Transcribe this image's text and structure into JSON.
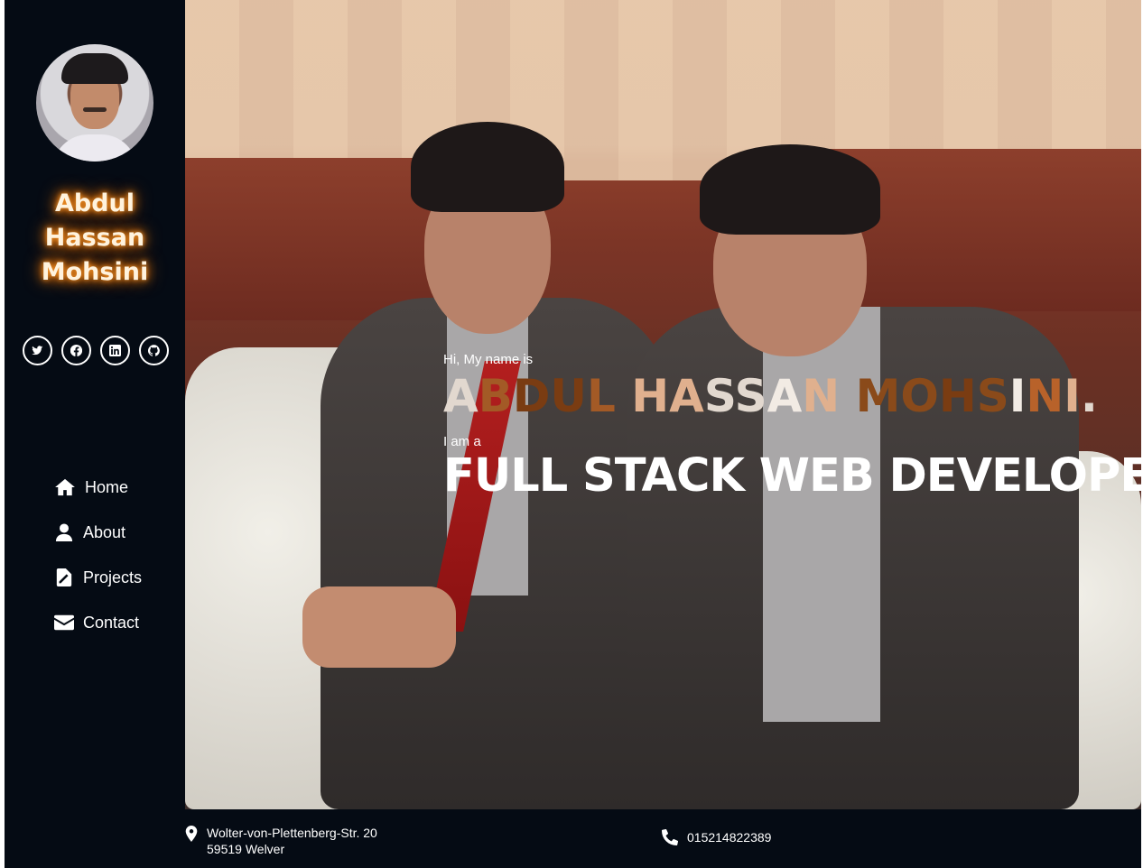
{
  "sidebar": {
    "name_lines": [
      "Abdul",
      "Hassan",
      "Mohsini"
    ],
    "social": [
      {
        "icon": "twitter-icon"
      },
      {
        "icon": "facebook-icon"
      },
      {
        "icon": "linkedin-icon"
      },
      {
        "icon": "github-icon"
      }
    ],
    "nav": [
      {
        "label": "Home",
        "icon": "home-icon"
      },
      {
        "label": "About",
        "icon": "user-icon"
      },
      {
        "label": "Projects",
        "icon": "file-icon"
      },
      {
        "label": "Contact",
        "icon": "envelope-icon"
      }
    ]
  },
  "hero": {
    "greeting": "Hi, My name is",
    "name": "ABDUL HASSAN MOHSINI.",
    "intro": "I am a",
    "role": "FULL STACK WEB DEVELOPER."
  },
  "footer": {
    "address_line1": "Wolter-von-Plettenberg-Str. 20",
    "address_line2": "59519 Welver",
    "phone": "015214822389"
  },
  "colors": {
    "sidebar_bg": "#050b14",
    "name_glow": "#ff7a00"
  }
}
